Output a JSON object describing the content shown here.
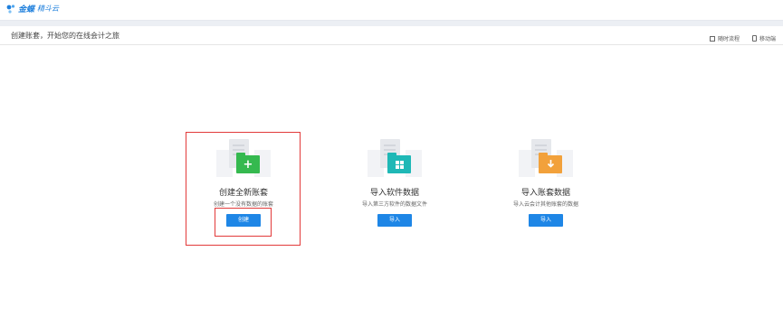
{
  "app": {
    "brand": "金蝶",
    "product": "精斗云"
  },
  "page": {
    "title": "创建账套，开始您的在线会计之旅"
  },
  "tools": [
    {
      "label": "随时流程",
      "icon": "doc-icon"
    },
    {
      "label": "移动端",
      "icon": "phone-icon"
    }
  ],
  "cards": [
    {
      "title": "创建全新账套",
      "desc": "创建一个没有数据的账套",
      "button": "创建",
      "color": "#35b94f",
      "icon": "plus-icon"
    },
    {
      "title": "导入软件数据",
      "desc": "导入第三方软件的数据文件",
      "button": "导入",
      "color": "#1fb8b6",
      "icon": "grid-icon"
    },
    {
      "title": "导入账套数据",
      "desc": "导入云会计其他账套的数据",
      "button": "导入",
      "color": "#f2a13b",
      "icon": "download-arrow-icon"
    }
  ],
  "colors": {
    "accent": "#1e86e6",
    "highlight": "#e23a3a"
  }
}
